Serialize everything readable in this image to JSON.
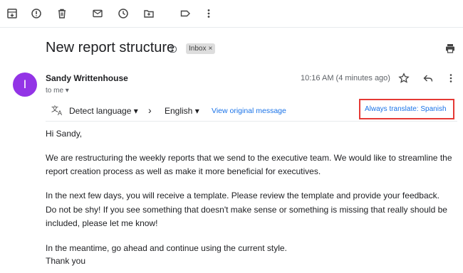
{
  "toolbar": {
    "icons": [
      "archive-icon",
      "report-spam-icon",
      "delete-icon",
      "mark-unread-icon",
      "snooze-icon",
      "move-to-icon",
      "label-icon",
      "more-icon"
    ]
  },
  "email": {
    "subject": "New report structure",
    "importance_marker": "ᗤ",
    "label": "Inbox",
    "label_close": "×",
    "sender_initial": "I",
    "sender_name": "Sandy Writtenhouse",
    "to_me": "to me ▾",
    "timestamp": "10:16 AM (4 minutes ago)"
  },
  "translate": {
    "detect_language": "Detect language ▾",
    "arrow": "›",
    "target_language": "English ▾",
    "view_original": "View original message",
    "always_translate": "Always translate: Spanish"
  },
  "body": {
    "greeting": "Hi Sandy,",
    "p1_line1": "We are restructuring the weekly reports that we send to the executive team. We would like to streamline the",
    "p1_line2": "report creation process as well as make it more beneficial for executives.",
    "p2_line1": "In the next few days, you will receive a template. Please review the template and provide your feedback.",
    "p2_line2": "Do not be shy! If you see something that doesn't make sense or something is missing that really should be",
    "p2_line3": "included, please let me know!",
    "p3_line1": "In the meantime, go ahead and continue using the current style.",
    "p3_line2": "Thank you"
  },
  "colors": {
    "avatar": "#9334e6",
    "link": "#1a73e8",
    "highlight_border": "#e53935"
  }
}
